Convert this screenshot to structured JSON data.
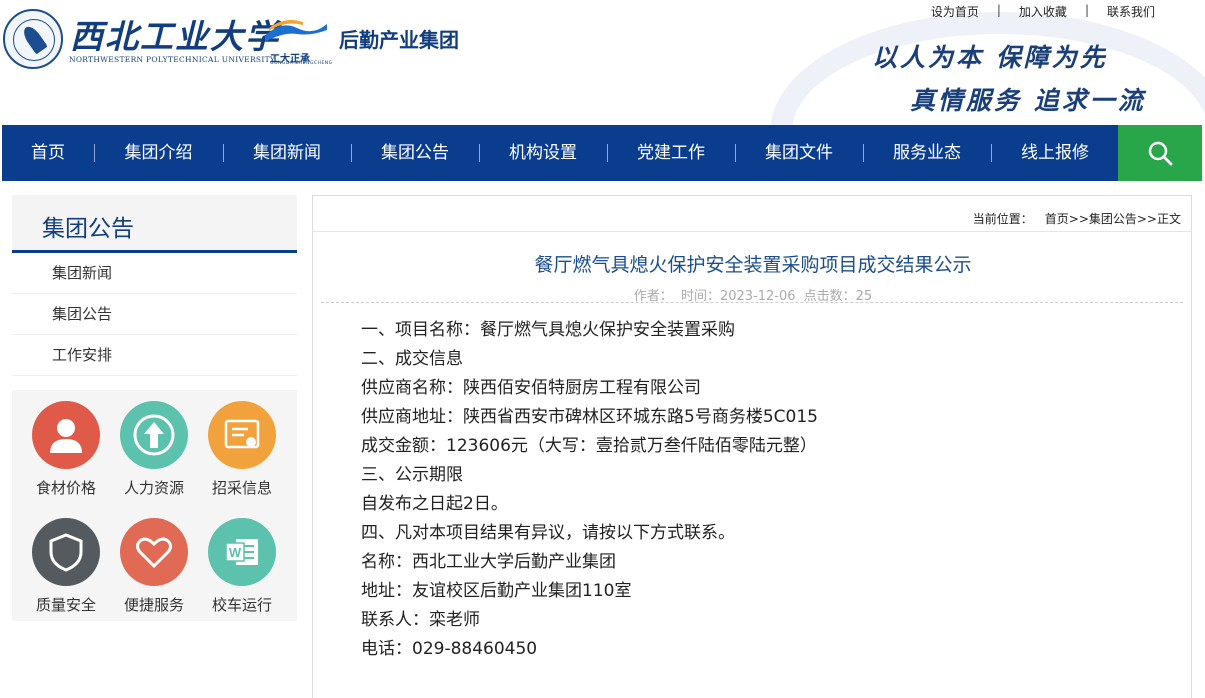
{
  "header": {
    "university_name": "西北工业大学",
    "university_en": "NORTHWESTERN POLYTECHNICAL UNIVERSITY",
    "sublogo": "工大正承",
    "sublogo_small": "GONGDA ZHENGCHENG",
    "group_name": "后勤产业集团",
    "top_links": [
      "设为首页",
      "加入收藏",
      "联系我们"
    ],
    "slogan_line1": "以人为本 保障为先",
    "slogan_line2": "真情服务 追求一流",
    "colors": {
      "brand_blue": "#0b3d8f",
      "search_green": "#2aa64a"
    }
  },
  "nav": {
    "items": [
      "首页",
      "集团介绍",
      "集团新闻",
      "集团公告",
      "机构设置",
      "党建工作",
      "集团文件",
      "服务业态",
      "线上报修"
    ],
    "search_icon": "search-icon"
  },
  "sidebar": {
    "title": "集团公告",
    "items": [
      "集团新闻",
      "集团公告",
      "工作安排"
    ]
  },
  "quick_links": [
    {
      "label": "食材价格",
      "icon": "person-icon",
      "color": "#e05a4a"
    },
    {
      "label": "人力资源",
      "icon": "upload-person-icon",
      "color": "#5cc2ad"
    },
    {
      "label": "招采信息",
      "icon": "certificate-icon",
      "color": "#f2a23d"
    },
    {
      "label": "质量安全",
      "icon": "shield-icon",
      "color": "#555a5e"
    },
    {
      "label": "便捷服务",
      "icon": "heart-icon",
      "color": "#e06a54"
    },
    {
      "label": "校车运行",
      "icon": "word-doc-icon",
      "color": "#5cc2ad"
    }
  ],
  "breadcrumb": {
    "prefix": "当前位置：",
    "path": "首页>>集团公告>>正文"
  },
  "article": {
    "title": "餐厅燃气具熄火保护安全装置采购项目成交结果公示",
    "meta_author": "作者：",
    "meta_time": "时间：2023-12-06",
    "meta_clicks": "点击数：25",
    "lines": [
      "一、项目名称：餐厅燃气具熄火保护安全装置采购",
      "二、成交信息",
      "供应商名称：陕西佰安佰特厨房工程有限公司",
      "供应商地址：陕西省西安市碑林区环城东路5号商务楼5C015",
      "成交金额：123606元（大写：壹拾贰万叁仟陆佰零陆元整）",
      "三、公示期限",
      "自发布之日起2日。",
      "四、凡对本项目结果有异议，请按以下方式联系。",
      "名称：西北工业大学后勤产业集团",
      "地址：友谊校区后勤产业集团110室",
      "联系人：栾老师",
      "电话：029-88460450"
    ]
  }
}
